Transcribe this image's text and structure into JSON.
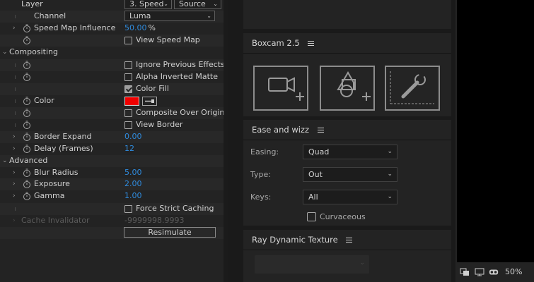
{
  "effect_controls": {
    "layer": {
      "label": "Layer",
      "layer_select": "3. Speed",
      "source_select": "Source"
    },
    "channel": {
      "label": "Channel",
      "value": "Luma"
    },
    "speed_map_influence": {
      "label": "Speed Map Influence",
      "value": "50.00",
      "unit": "%"
    },
    "view_speed_map": {
      "label": "View Speed Map",
      "checked": false
    },
    "compositing": {
      "label": "Compositing"
    },
    "ignore_previous_effects": {
      "label": "Ignore Previous Effects",
      "checked": false
    },
    "alpha_inverted_matte": {
      "label": "Alpha Inverted Matte",
      "checked": false
    },
    "color_fill": {
      "label": "Color Fill",
      "checked": true
    },
    "color": {
      "label": "Color",
      "swatch": "#f00000"
    },
    "composite_over_original": {
      "label": "Composite Over Original",
      "checked": false
    },
    "view_border": {
      "label": "View Border",
      "checked": false
    },
    "border_expand": {
      "label": "Border Expand",
      "value": "0.00"
    },
    "delay_frames": {
      "label": "Delay (Frames)",
      "value": "12"
    },
    "advanced": {
      "label": "Advanced"
    },
    "blur_radius": {
      "label": "Blur Radius",
      "value": "5.00"
    },
    "exposure": {
      "label": "Exposure",
      "value": "2.00"
    },
    "gamma": {
      "label": "Gamma",
      "value": "1.00"
    },
    "force_strict_caching": {
      "label": "Force Strict Caching",
      "checked": false
    },
    "cache_invalidator": {
      "label": "Cache Invalidator",
      "value": "-9999998.9993"
    },
    "resimulate_label": "Resimulate"
  },
  "boxcam": {
    "title": "Boxcam 2.5",
    "buttons": [
      "camera-add-icon",
      "shapes-add-icon",
      "wrench-icon"
    ]
  },
  "ease_and_wizz": {
    "title": "Ease and wizz",
    "easing": {
      "label": "Easing:",
      "value": "Quad"
    },
    "type": {
      "label": "Type:",
      "value": "Out"
    },
    "keys": {
      "label": "Keys:",
      "value": "All"
    },
    "curvaceous": {
      "label": "Curvaceous",
      "checked": false
    }
  },
  "ray_dynamic_texture": {
    "title": "Ray Dynamic Texture"
  },
  "viewer": {
    "zoom": "50%"
  },
  "colors": {
    "accent_value": "#2f8bdd",
    "panel_bg": "#232323",
    "swatch_red": "#f00000"
  }
}
